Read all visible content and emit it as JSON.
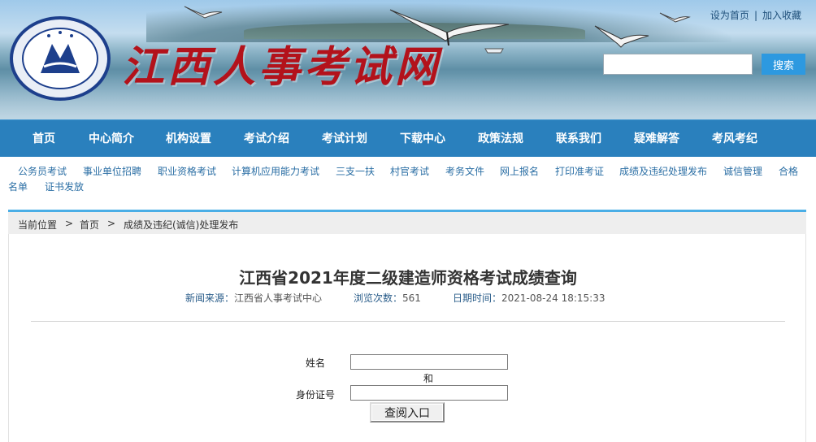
{
  "header": {
    "site_name": "江西人事考试网",
    "logo_icon": "emblem-icon",
    "links": {
      "set_home": "设为首页",
      "separator": "|",
      "add_favorite": "加入收藏"
    },
    "search": {
      "value": "",
      "button_label": "搜索"
    }
  },
  "nav": {
    "items": [
      {
        "label": "首页"
      },
      {
        "label": "中心简介"
      },
      {
        "label": "机构设置"
      },
      {
        "label": "考试介绍"
      },
      {
        "label": "考试计划"
      },
      {
        "label": "下载中心"
      },
      {
        "label": "政策法规"
      },
      {
        "label": "联系我们"
      },
      {
        "label": "疑难解答"
      },
      {
        "label": "考风考纪"
      }
    ]
  },
  "subnav": {
    "items": [
      {
        "label": "公务员考试"
      },
      {
        "label": "事业单位招聘"
      },
      {
        "label": "职业资格考试"
      },
      {
        "label": "计算机应用能力考试"
      },
      {
        "label": "三支一扶"
      },
      {
        "label": "村官考试"
      },
      {
        "label": "考务文件"
      },
      {
        "label": "网上报名"
      },
      {
        "label": "打印准考证"
      },
      {
        "label": "成绩及违纪处理发布"
      },
      {
        "label": "诚信管理"
      },
      {
        "label": "合格"
      },
      {
        "label": "名单"
      },
      {
        "label": "证书发放"
      }
    ]
  },
  "breadcrumb": {
    "prefix": "当前位置",
    "arrow": ">",
    "home": "首页",
    "current": "成绩及违纪(诚信)处理发布"
  },
  "article": {
    "title": "江西省2021年度二级建造师资格考试成绩查询",
    "source_label": "新闻来源：",
    "source_value": "江西省人事考试中心",
    "views_label": "浏览次数：",
    "views_value": "561",
    "date_label": "日期时间：",
    "date_value": "2021-08-24 18:15:33"
  },
  "form": {
    "name_label": "姓名",
    "name_value": "",
    "and_text": "和",
    "id_label": "身份证号",
    "id_value": "",
    "submit_label": "查阅入口"
  },
  "colors": {
    "nav_bg": "#2a80bd",
    "accent": "#4aaee6",
    "site_name": "#b3121b",
    "link": "#2a6ea4"
  }
}
